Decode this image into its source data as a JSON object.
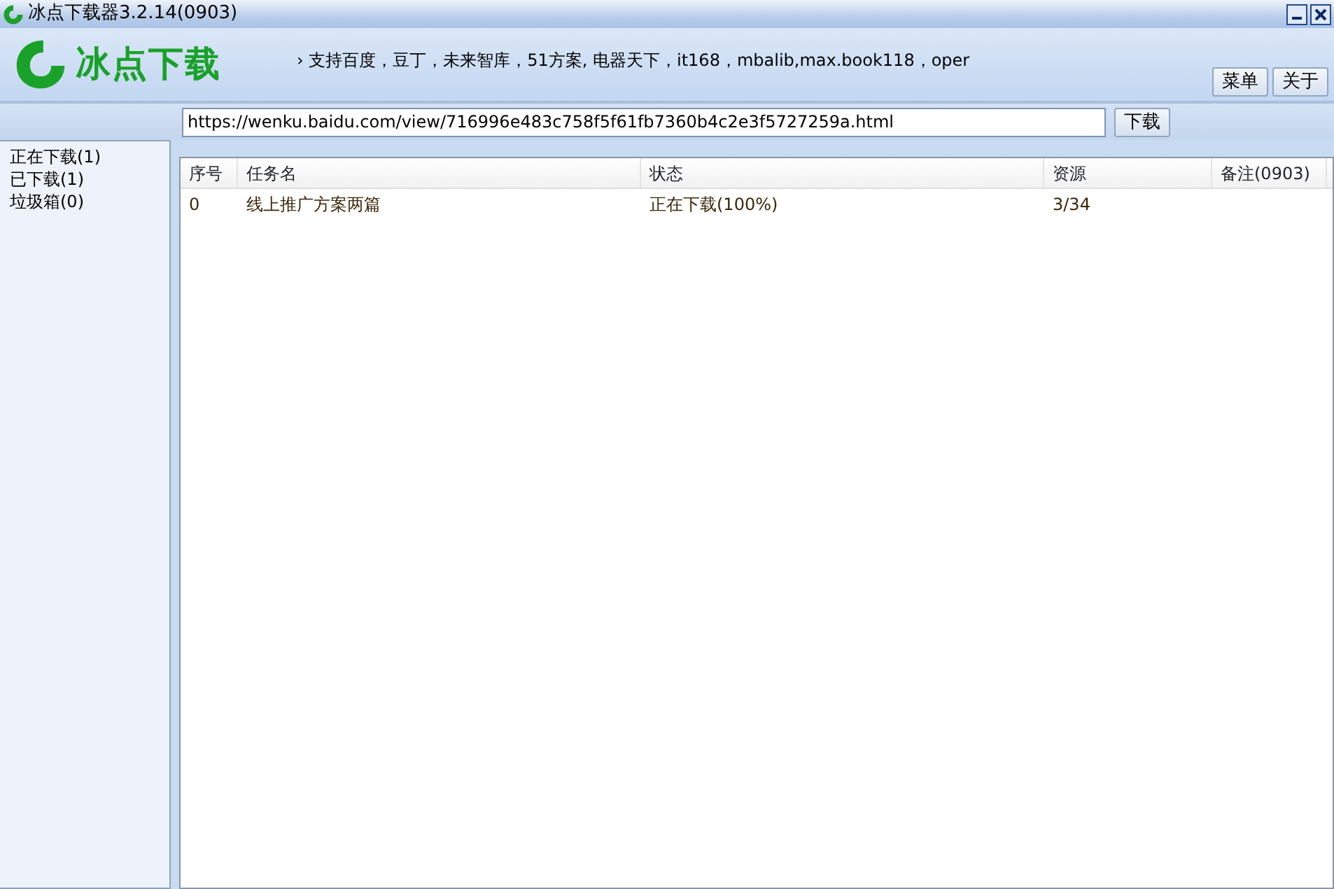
{
  "window": {
    "title": "冰点下载器3.2.14(0903)"
  },
  "header": {
    "logo_text": "冰点下载",
    "notice": "› 支持百度，豆丁，未来智库，51方案, 电器天下，it168，mbalib,max.book118，oper",
    "buttons": [
      "菜单",
      "关于"
    ]
  },
  "url_bar": {
    "value": "https://wenku.baidu.com/view/716996e483c758f5f61fb7360b4c2e3f5727259a.html",
    "button": "下载"
  },
  "sidebar": {
    "items": [
      {
        "label": "正在下载(1)",
        "selected": false
      },
      {
        "label": "已下载(1)",
        "selected": false
      },
      {
        "label": "垃圾箱(0)",
        "selected": false
      }
    ]
  },
  "table": {
    "columns": [
      "序号",
      "任务名",
      "状态",
      "资源",
      "备注(0903)"
    ],
    "rows": [
      [
        "0",
        "线上推广方案两篇",
        "正在下载(100%)",
        "3/34",
        ""
      ]
    ]
  }
}
